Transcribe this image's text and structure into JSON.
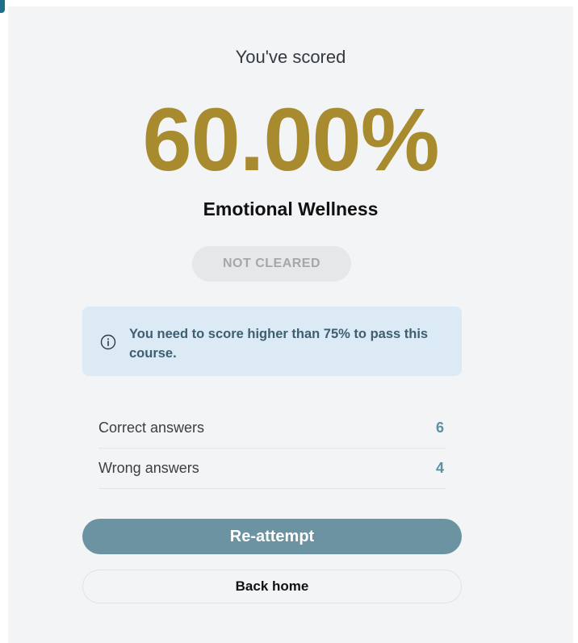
{
  "header": {
    "subtitle": "You've scored"
  },
  "result": {
    "score": "60.00%",
    "course_title": "Emotional Wellness",
    "status": "NOT CLEARED"
  },
  "info": {
    "icon": "info-circle-icon",
    "message": "You need to score higher than 75% to pass this course."
  },
  "stats": [
    {
      "label": "Correct answers",
      "value": "6"
    },
    {
      "label": "Wrong answers",
      "value": "4"
    }
  ],
  "actions": {
    "reattempt_label": "Re-attempt",
    "home_label": "Back home"
  },
  "colors": {
    "score_gold": "#a88b2e",
    "accent_teal": "#6b93a2",
    "info_bg": "#dceaf5",
    "stat_value": "#5d8fa3"
  }
}
